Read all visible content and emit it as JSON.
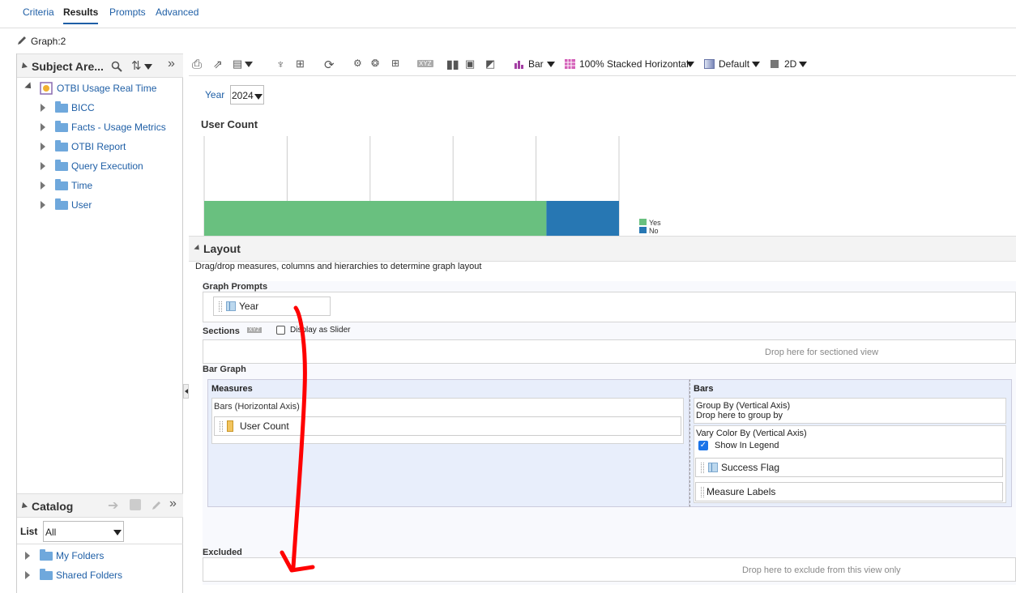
{
  "tabs": [
    "Criteria",
    "Results",
    "Prompts",
    "Advanced"
  ],
  "graph_label": "Graph:2",
  "subject_area": {
    "title": "Subject Are...",
    "root": "OTBI Usage Real Time",
    "folders": [
      "BICC",
      "Facts - Usage Metrics",
      "OTBI Report",
      "Query Execution",
      "Time",
      "User"
    ]
  },
  "catalog": {
    "title": "Catalog",
    "list_label": "List",
    "list_value": "All",
    "folders": [
      "My Folders",
      "Shared Folders"
    ]
  },
  "toolbar": {
    "graph_type": "Bar",
    "subtype": "100% Stacked Horizontal",
    "style": "Default",
    "dimension": "2D",
    "xyz_label": "XYZ"
  },
  "preview": {
    "prompt_label": "Year",
    "prompt_value": "2024",
    "chart_title": "User Count",
    "legend": [
      {
        "label": "Yes",
        "color": "#69c07f"
      },
      {
        "label": "No",
        "color": "#2777b3"
      }
    ]
  },
  "chart_data": {
    "type": "bar",
    "orientation": "horizontal",
    "stacked": "100%",
    "title": "User Count",
    "series": [
      {
        "name": "Yes",
        "values": [
          0.825
        ]
      },
      {
        "name": "No",
        "values": [
          0.175
        ]
      }
    ],
    "xlim": [
      0,
      1
    ],
    "grid": true,
    "legend": "right"
  },
  "layout": {
    "title": "Layout",
    "description": "Drag/drop measures, columns and hierarchies to determine graph layout",
    "graph_prompts": "Graph Prompts",
    "prompt_chip": "Year",
    "sections": "Sections",
    "sections_xyz": "XYZ",
    "display_as_slider": "Display as Slider",
    "drop_sectioned": "Drop here for sectioned view",
    "bar_graph": "Bar Graph",
    "measures": "Measures",
    "bars_axis": "Bars (Horizontal Axis)",
    "measure_chip": "User Count",
    "bars": "Bars",
    "group_by": "Group By (Vertical Axis)",
    "drop_group": "Drop here to group by",
    "vary_color": "Vary Color By (Vertical Axis)",
    "show_legend": "Show In Legend",
    "success_flag": "Success Flag",
    "measure_labels": "Measure Labels",
    "excluded": "Excluded",
    "drop_exclude": "Drop here to exclude from this view only"
  }
}
